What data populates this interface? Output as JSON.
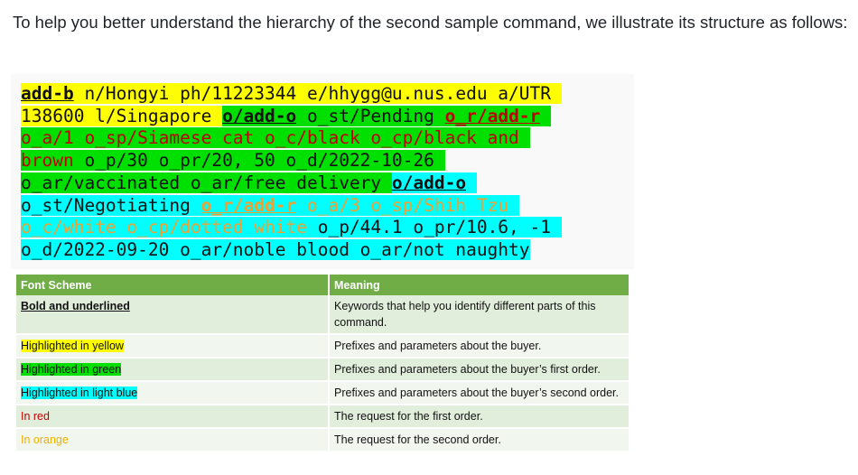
{
  "intro_text": "To help you better understand the hierarchy of the second sample command, we illustrate its structure as follows:",
  "command_lines": [
    [
      {
        "text": "add-b",
        "bg": "y",
        "kw": true
      },
      {
        "text": " n/Hongyi ph/11223344 e/hhygg@u.nus.edu a/UTR ",
        "bg": "y"
      }
    ],
    [
      {
        "text": "138600 l/Singapore ",
        "bg": "y"
      },
      {
        "text": "o/add-o",
        "bg": "g",
        "kw": true
      },
      {
        "text": " o_st/Pending ",
        "bg": "g"
      },
      {
        "text": "o_r/add-r",
        "bg": "g",
        "color": "red",
        "kw": true
      },
      {
        "text": " ",
        "bg": "g"
      }
    ],
    [
      {
        "text": "o_a/1 o_sp/Siamese cat o_c/black o_cp/black and ",
        "bg": "g",
        "color": "red"
      }
    ],
    [
      {
        "text": "brown",
        "bg": "g",
        "color": "red"
      },
      {
        "text": " o_p/30 o_pr/20, 50 o_d/2022-10-26 ",
        "bg": "g"
      }
    ],
    [
      {
        "text": "o_ar/vaccinated o_ar/free delivery ",
        "bg": "g"
      },
      {
        "text": "o/add-o",
        "bg": "b",
        "kw": true
      },
      {
        "text": " ",
        "bg": "b"
      }
    ],
    [
      {
        "text": "o_st/Negotiating ",
        "bg": "b"
      },
      {
        "text": "o_r/add-r",
        "bg": "b",
        "color": "org",
        "kw": true
      },
      {
        "text": " o_a/3 o_sp/Shih Tzu ",
        "bg": "b",
        "color": "org"
      }
    ],
    [
      {
        "text": "o_c/white o_cp/dotted white",
        "bg": "b",
        "color": "org"
      },
      {
        "text": " o_p/44.1 o_pr/10.6, -1 ",
        "bg": "b"
      }
    ],
    [
      {
        "text": "o_d/2022-09-20 o_ar/noble blood o_ar/not naughty",
        "bg": "b"
      }
    ]
  ],
  "table": {
    "header": [
      "Font Scheme",
      "Meaning"
    ],
    "rows": [
      {
        "scheme": "Bold and underlined",
        "style": "bold-underline",
        "meaning": "Keywords that help you identify different parts of this command."
      },
      {
        "scheme": "Highlighted in yellow",
        "style": "yellow",
        "meaning": "Prefixes and parameters about the buyer."
      },
      {
        "scheme": "Highlighted in green",
        "style": "green",
        "meaning": "Prefixes and parameters about the buyer’s first order."
      },
      {
        "scheme": "Highlighted in light blue",
        "style": "blue",
        "meaning": "Prefixes and parameters about the buyer’s second order."
      },
      {
        "scheme": "In red",
        "style": "red",
        "meaning": "The request for the first order."
      },
      {
        "scheme": "In orange",
        "style": "orange",
        "meaning": "The request for the second order."
      }
    ]
  },
  "colors": {
    "yellow": "#ffff00",
    "green": "#00e000",
    "light_blue": "#00ffff",
    "red": "#c00000",
    "orange": "#f0a030",
    "table_header": "#70ad47"
  }
}
